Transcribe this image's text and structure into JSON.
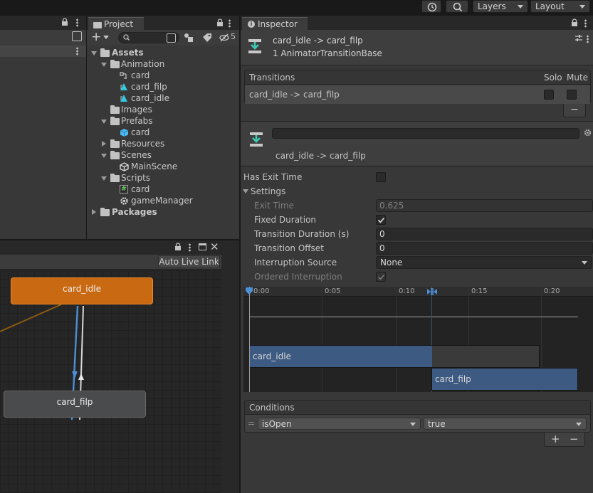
{
  "toolbar": {
    "layers_label": "Layers",
    "layout_label": "Layout",
    "history_icon": "history-icon",
    "search_icon": "search-icon"
  },
  "project": {
    "tab_label": "Project",
    "hidden_count": "5",
    "tree": {
      "assets": "Assets",
      "animation": "Animation",
      "anim_card": "card",
      "anim_card_filp": "card_filp",
      "anim_card_idle": "card_idle",
      "images": "Images",
      "prefabs": "Prefabs",
      "prefab_card": "card",
      "resources": "Resources",
      "scenes": "Scenes",
      "main_scene": "MainScene",
      "scripts": "Scripts",
      "script_card": "card",
      "game_manager": "gameManager",
      "packages": "Packages"
    }
  },
  "animator": {
    "auto_live_link": "Auto Live Link",
    "nodes": {
      "idle": "card_idle",
      "filp": "card_filp"
    },
    "colors": {
      "default_state": "#c96a12",
      "state": "#4a4b4d"
    }
  },
  "inspector": {
    "tab_label": "Inspector",
    "title": "card_idle -> card_filp",
    "subtitle": "1 AnimatorTransitionBase",
    "transitions": {
      "header": "Transitions",
      "solo": "Solo",
      "mute": "Mute",
      "row": "card_idle -> card_filp",
      "remove": "−"
    },
    "transition_name": "card_idle -> card_filp",
    "has_exit_time": "Has Exit Time",
    "settings": "Settings",
    "exit_time_label": "Exit Time",
    "exit_time_value": "0.625",
    "fixed_duration_label": "Fixed Duration",
    "duration_label": "Transition Duration (s)",
    "duration_value": "0",
    "offset_label": "Transition Offset",
    "offset_value": "0",
    "interruption_label": "Interruption Source",
    "interruption_value": "None",
    "ordered_label": "Ordered Interruption",
    "timeline": {
      "ticks": [
        "0:00",
        "0:05",
        "0:10",
        "0:15",
        "0:20"
      ],
      "clip_a": "card_idle",
      "clip_b": "card_filp"
    },
    "conditions": {
      "header": "Conditions",
      "param": "isOpen",
      "value": "true",
      "add": "+",
      "remove": "−"
    }
  }
}
